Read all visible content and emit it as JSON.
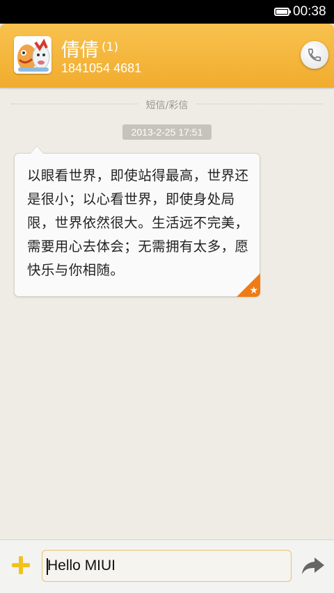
{
  "status_bar": {
    "time": "00:38"
  },
  "header": {
    "contact_name": "倩倩",
    "unread_count": "(1)",
    "phone_number": "1841054 4681",
    "call_icon": "phone-icon"
  },
  "conversation": {
    "channel_label": "短信/彩信",
    "timestamp": "2013-2-25 17:51",
    "message": "以眼看世界，即使站得最高，世界还是很小；以心看世界，即使身处局限，世界依然很大。生活远不完美，需要用心去体会；无需拥有太多，愿快乐与你相随。",
    "starred_icon": "star-icon"
  },
  "composer": {
    "input_value": "Hello MIUI",
    "attach_icon": "plus-icon",
    "send_icon": "send-arrow-icon"
  },
  "colors": {
    "header": "#f4b43b",
    "star_badge": "#ef7b15",
    "attach": "#f2c21c",
    "background": "#efece6"
  }
}
